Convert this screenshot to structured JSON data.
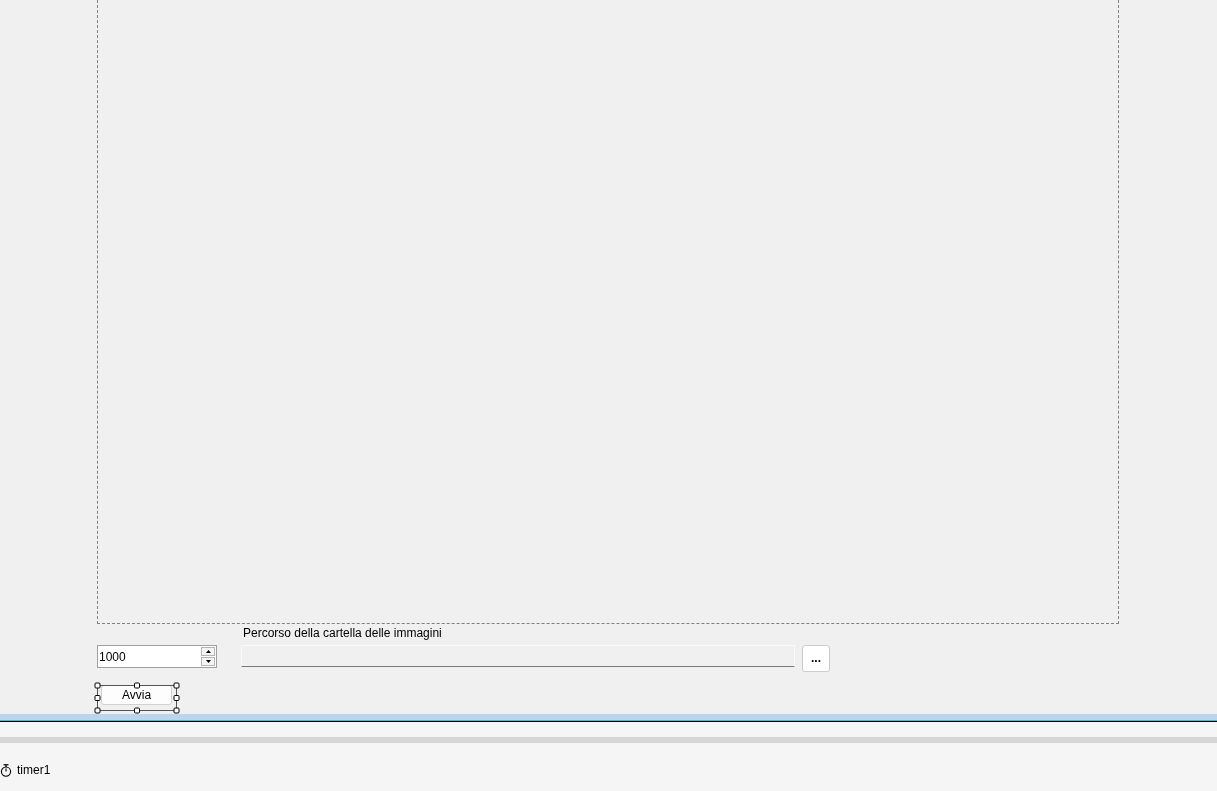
{
  "form": {
    "interval_input": {
      "value": "1000"
    },
    "folder_path_label": "Percorso della cartella delle immagini",
    "folder_path_input": {
      "readonly": true
    },
    "browse_button": {
      "label": "..."
    },
    "start_button": {
      "label": "Avvia",
      "selected": true
    }
  },
  "component_tray": [
    {
      "kind": "timer",
      "label": "timer1"
    }
  ]
}
